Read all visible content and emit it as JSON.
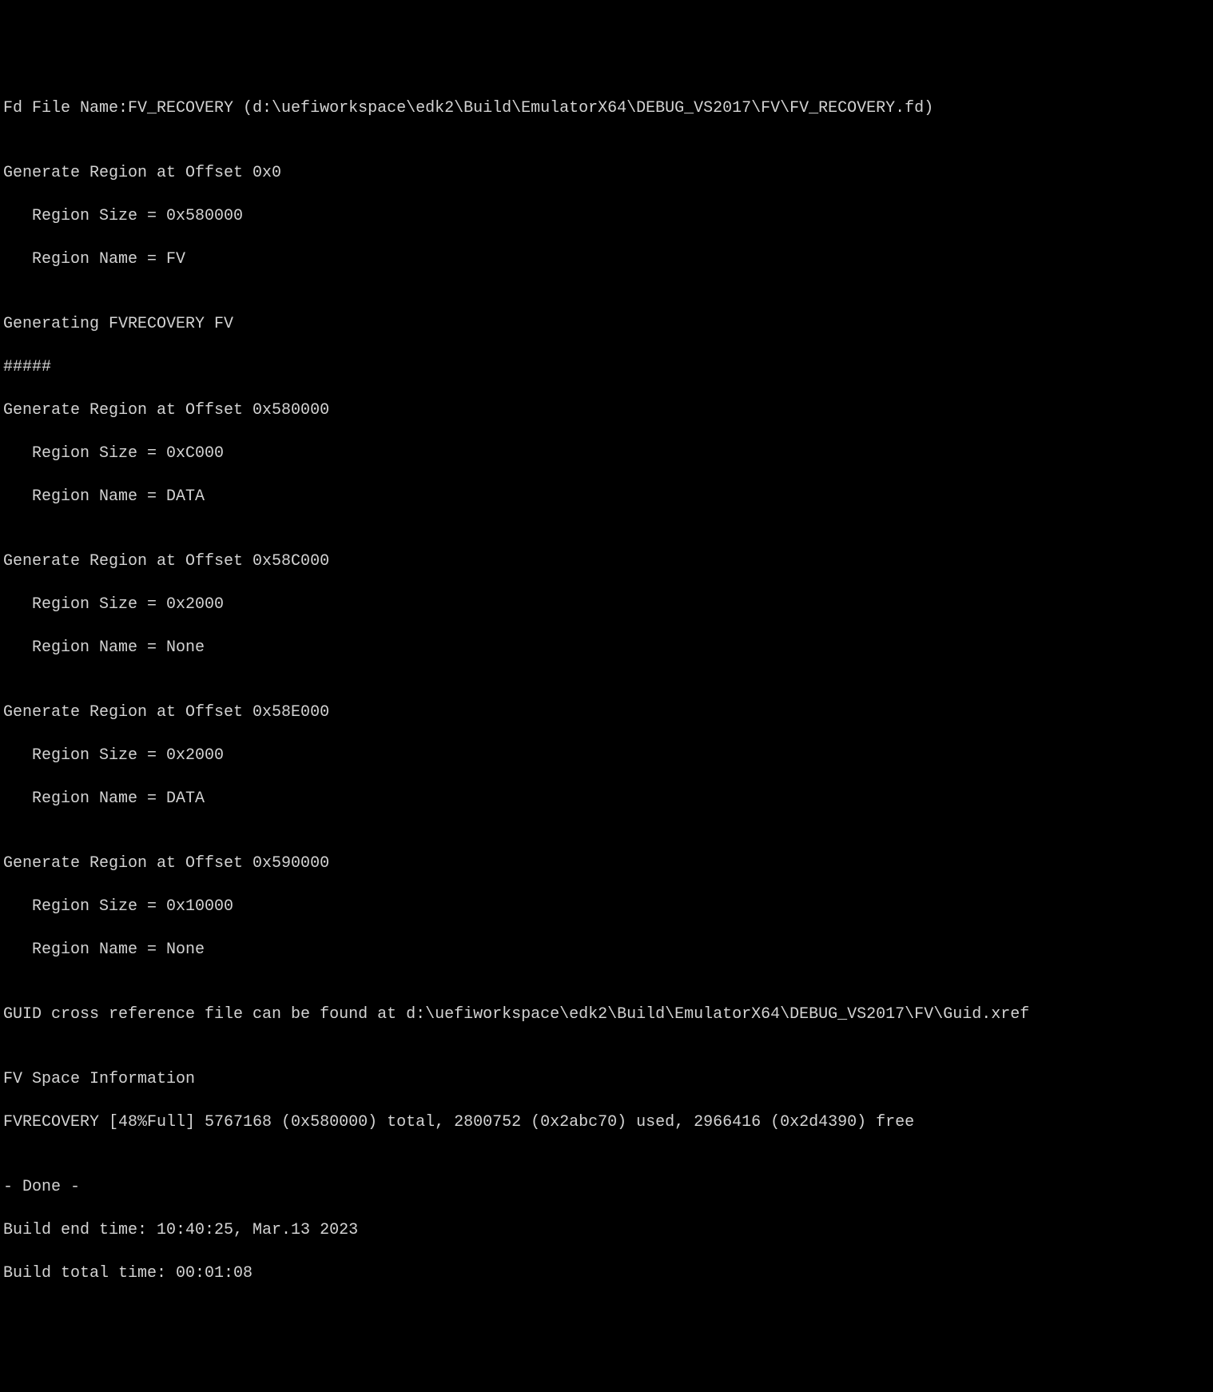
{
  "terminal": {
    "fd_file_line": "Fd File Name:FV_RECOVERY (d:\\uefiworkspace\\edk2\\Build\\EmulatorX64\\DEBUG_VS2017\\FV\\FV_RECOVERY.fd)",
    "blank1": "",
    "region1_header": "Generate Region at Offset 0x0",
    "region1_size": "   Region Size = 0x580000",
    "region1_name": "   Region Name = FV",
    "blank2": "",
    "generating_fv": "Generating FVRECOVERY FV",
    "hashes": "#####",
    "region2_header": "Generate Region at Offset 0x580000",
    "region2_size": "   Region Size = 0xC000",
    "region2_name": "   Region Name = DATA",
    "blank3": "",
    "region3_header": "Generate Region at Offset 0x58C000",
    "region3_size": "   Region Size = 0x2000",
    "region3_name": "   Region Name = None",
    "blank4": "",
    "region4_header": "Generate Region at Offset 0x58E000",
    "region4_size": "   Region Size = 0x2000",
    "region4_name": "   Region Name = DATA",
    "blank5": "",
    "region5_header": "Generate Region at Offset 0x590000",
    "region5_size": "   Region Size = 0x10000",
    "region5_name": "   Region Name = None",
    "blank6": "",
    "guid_xref": "GUID cross reference file can be found at d:\\uefiworkspace\\edk2\\Build\\EmulatorX64\\DEBUG_VS2017\\FV\\Guid.xref",
    "blank7": "",
    "fv_space_header": "FV Space Information",
    "fv_space_detail": "FVRECOVERY [48%Full] 5767168 (0x580000) total, 2800752 (0x2abc70) used, 2966416 (0x2d4390) free",
    "blank8": "",
    "done": "- Done -",
    "build_end": "Build end time: 10:40:25, Mar.13 2023",
    "build_total": "Build total time: 00:01:08"
  }
}
